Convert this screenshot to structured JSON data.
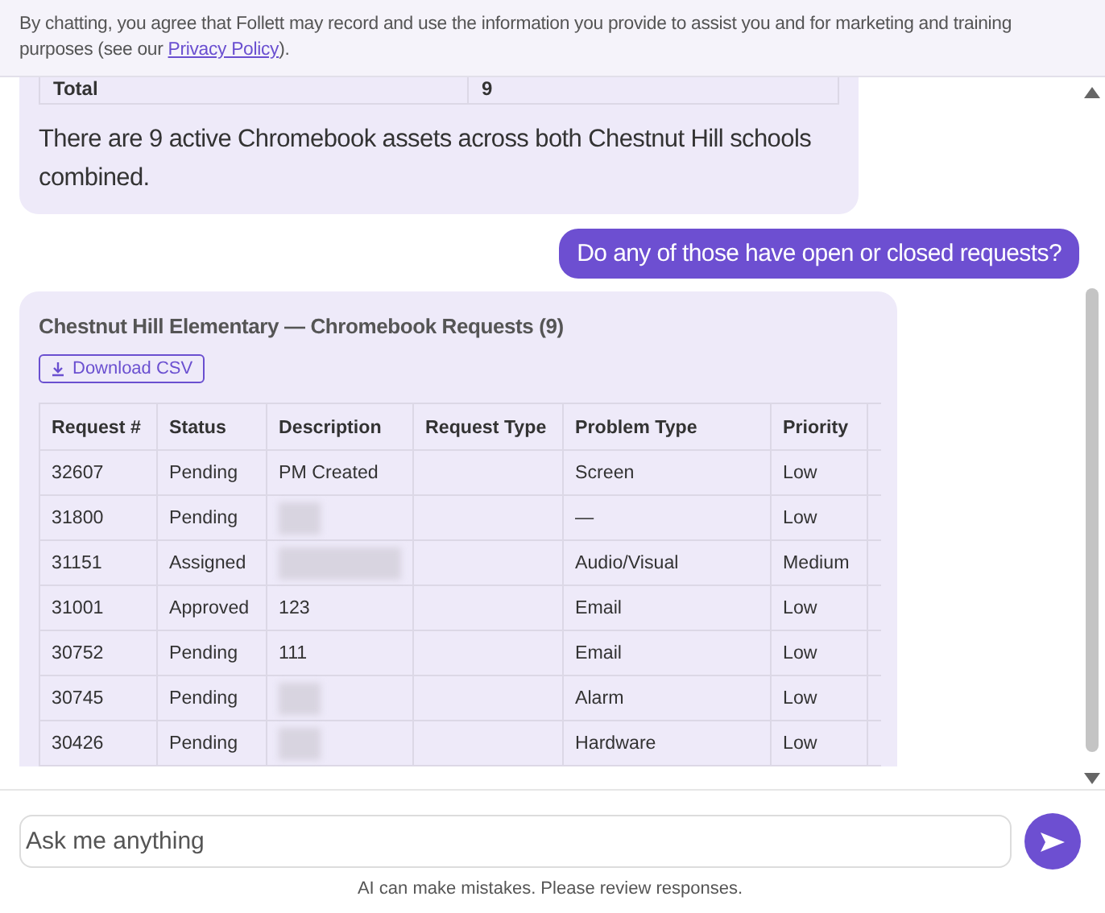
{
  "notice": {
    "text": "By chatting, you agree that Follett may record and use the information you provide to assist you and for marketing and training purposes (see our ",
    "link": "Privacy Policy",
    "after": ")."
  },
  "messages": [
    {
      "kind": "assistant",
      "summary_row": [
        "Total",
        "9"
      ],
      "text": "There are 9 active Chromebook assets across both Chestnut Hill schools combined."
    },
    {
      "kind": "user",
      "text": "Do any of those have open or closed requests?"
    },
    {
      "kind": "report",
      "title": "Chestnut Hill Elementary — Chromebook Requests (9)",
      "button": "Download CSV",
      "columns": [
        "Request #",
        "Status",
        "Description",
        "Request Type",
        "Problem Type",
        "Priority"
      ],
      "rows": [
        {
          "cells": [
            "32607",
            "Pending",
            "PM Created",
            "",
            "Screen",
            "Low"
          ],
          "description_blurred": false
        },
        {
          "cells": [
            "31800",
            "Pending",
            "",
            "",
            "—",
            "Low"
          ],
          "description_blurred": true
        },
        {
          "cells": [
            "31151",
            "Assigned",
            "",
            "",
            "Audio/Visual",
            "Medium"
          ],
          "description_blurred": true
        },
        {
          "cells": [
            "31001",
            "Approved",
            "123",
            "",
            "Email",
            "Low"
          ],
          "description_blurred": false
        },
        {
          "cells": [
            "30752",
            "Pending",
            "111",
            "",
            "Email",
            "Low"
          ],
          "description_blurred": false
        },
        {
          "cells": [
            "30745",
            "Pending",
            "",
            "",
            "Alarm",
            "Low"
          ],
          "description_blurred": true
        },
        {
          "cells": [
            "30426",
            "Pending",
            "",
            "",
            "Hardware",
            "Low"
          ],
          "description_blurred": true
        }
      ]
    }
  ],
  "input": {
    "placeholder": "Ask me anything"
  },
  "disclaimer": "AI can make mistakes. Please review responses."
}
